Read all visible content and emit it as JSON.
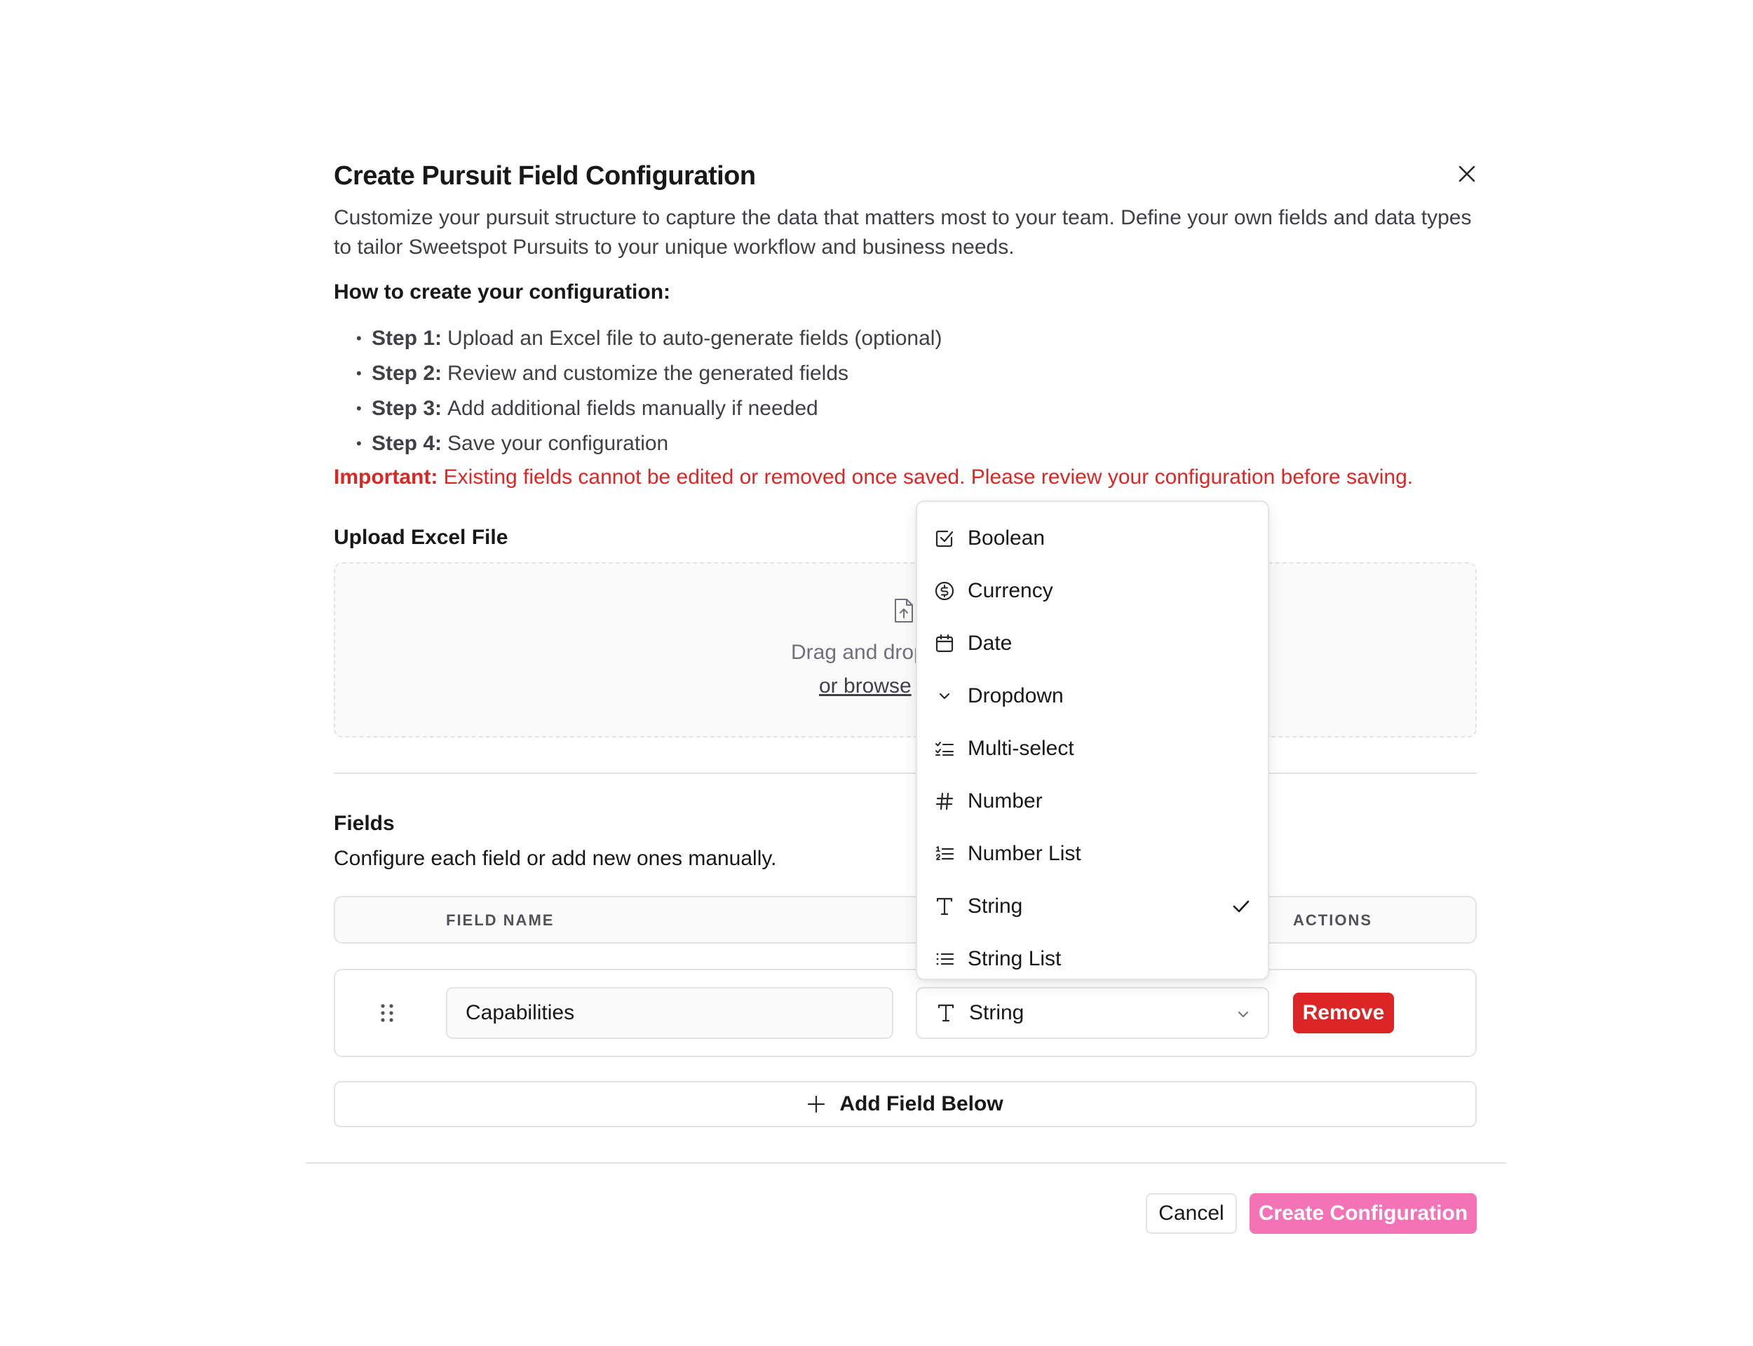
{
  "dialog": {
    "title": "Create Pursuit Field Configuration",
    "description": "Customize your pursuit structure to capture the data that matters most to your team. Define your own fields and data types to tailor Sweetspot Pursuits to your unique workflow and business needs.",
    "howto_heading": "How to create your configuration:",
    "steps": [
      {
        "label": "Step 1:",
        "text": "Upload an Excel file to auto-generate fields (optional)"
      },
      {
        "label": "Step 2:",
        "text": "Review and customize the generated fields"
      },
      {
        "label": "Step 3:",
        "text": "Add additional fields manually if needed"
      },
      {
        "label": "Step 4:",
        "text": "Save your configuration"
      }
    ],
    "important_label": "Important:",
    "important_text": "Existing fields cannot be edited or removed once saved. Please review your configuration before saving.",
    "close_icon": "close-icon"
  },
  "upload": {
    "label": "Upload Excel File",
    "dropzone_text": "Drag and drop",
    "browse_link": "or browse"
  },
  "fields": {
    "title": "Fields",
    "subtitle": "Configure each field or add new ones manually.",
    "columns": {
      "field_name": "FIELD NAME",
      "actions": "ACTIONS"
    },
    "rows": [
      {
        "name": "Capabilities",
        "type": "String",
        "type_icon": "text-icon",
        "remove_label": "Remove"
      }
    ],
    "add_button": "Add Field Below"
  },
  "type_menu": {
    "selected": "String",
    "options": [
      {
        "label": "Boolean",
        "icon": "checkbox-icon"
      },
      {
        "label": "Currency",
        "icon": "dollar-icon"
      },
      {
        "label": "Date",
        "icon": "calendar-icon"
      },
      {
        "label": "Dropdown",
        "icon": "chevron-down-icon"
      },
      {
        "label": "Multi-select",
        "icon": "checklist-icon"
      },
      {
        "label": "Number",
        "icon": "hash-icon"
      },
      {
        "label": "Number List",
        "icon": "numbered-list-icon"
      },
      {
        "label": "String",
        "icon": "text-icon"
      },
      {
        "label": "String List",
        "icon": "list-icon"
      }
    ]
  },
  "footer": {
    "cancel": "Cancel",
    "create": "Create Configuration"
  },
  "colors": {
    "danger": "#dc2626",
    "primary_pink": "#f472b6",
    "border": "#e4e4e7"
  }
}
